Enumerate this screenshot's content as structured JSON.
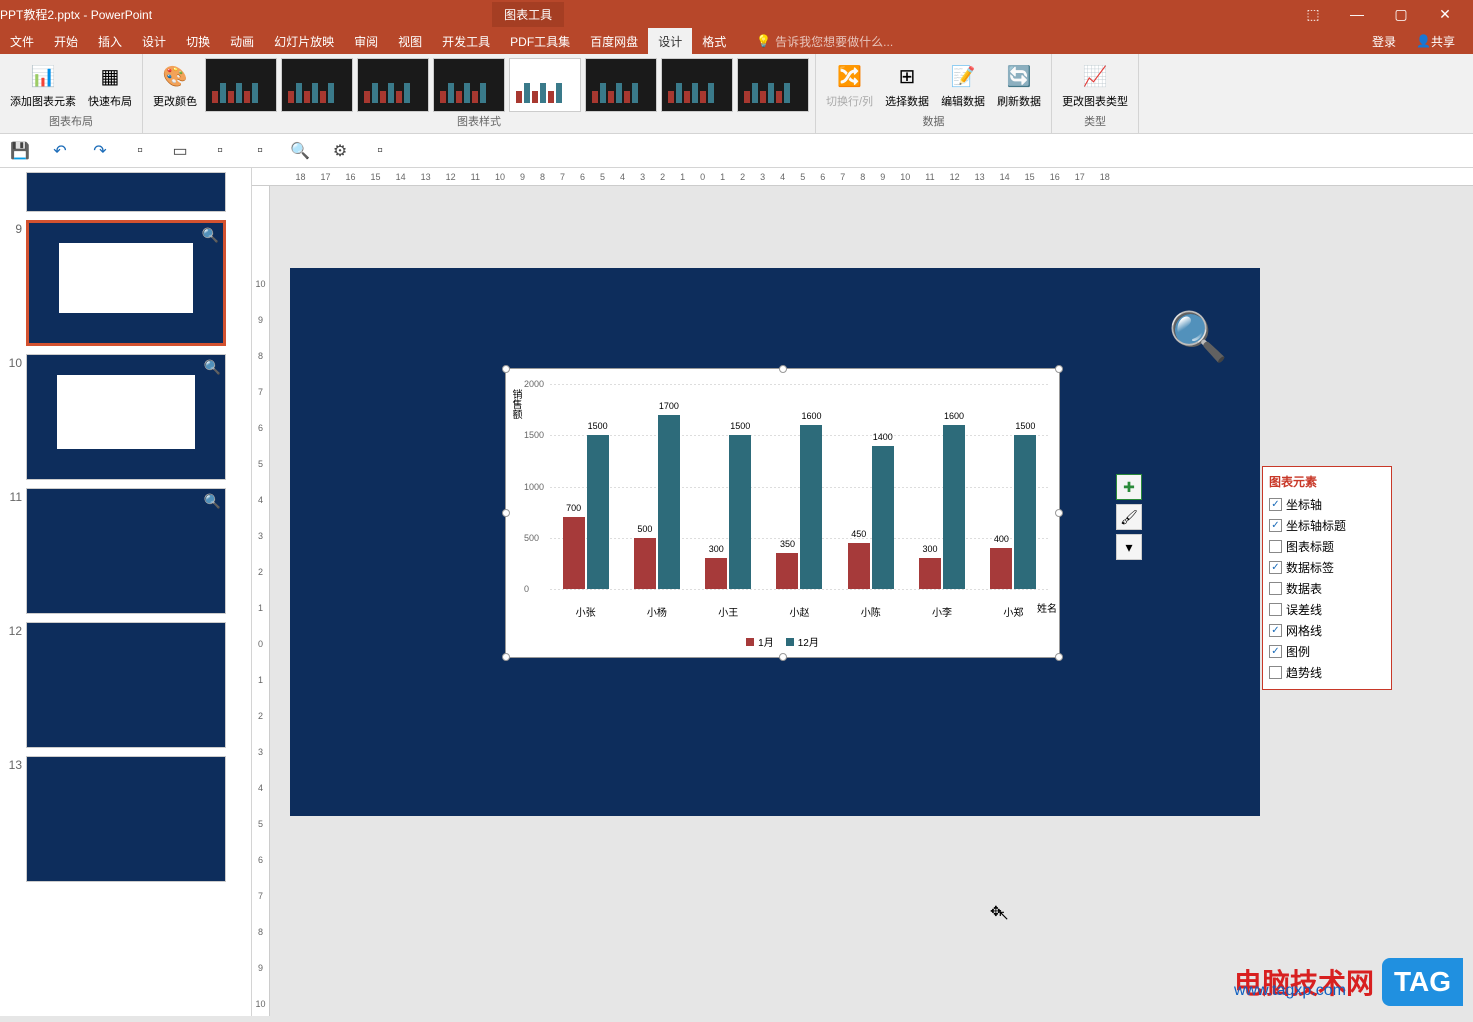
{
  "titlebar": {
    "title": "PPT教程2.pptx - PowerPoint",
    "context_tab": "图表工具"
  },
  "win": {
    "minimize": "—",
    "maximize": "▢",
    "close": "✕",
    "opts": "⬚"
  },
  "menu": {
    "items": [
      "文件",
      "开始",
      "插入",
      "设计",
      "切换",
      "动画",
      "幻灯片放映",
      "审阅",
      "视图",
      "开发工具",
      "PDF工具集",
      "百度网盘"
    ],
    "design": "设计",
    "format": "格式",
    "tell_me": "告诉我您想要做什么...",
    "login": "登录",
    "share": "共享"
  },
  "ribbon": {
    "add_element": "添加图表元素",
    "quick_layout": "快速布局",
    "change_color": "更改颜色",
    "group_layout": "图表布局",
    "group_styles": "图表样式",
    "switch_rc": "切换行/列",
    "select_data": "选择数据",
    "edit_data": "编辑数据",
    "refresh_data": "刷新数据",
    "group_data": "数据",
    "change_type": "更改图表类型",
    "group_type": "类型"
  },
  "ruler_h": [
    "18",
    "17",
    "16",
    "15",
    "14",
    "13",
    "12",
    "11",
    "10",
    "9",
    "8",
    "7",
    "6",
    "5",
    "4",
    "3",
    "2",
    "1",
    "0",
    "1",
    "2",
    "3",
    "4",
    "5",
    "6",
    "7",
    "8",
    "9",
    "10",
    "11",
    "12",
    "13",
    "14",
    "15",
    "16",
    "17",
    "18"
  ],
  "ruler_v": [
    "10",
    "9",
    "8",
    "7",
    "6",
    "5",
    "4",
    "3",
    "2",
    "1",
    "0",
    "1",
    "2",
    "3",
    "4",
    "5",
    "6",
    "7",
    "8",
    "9",
    "10"
  ],
  "thumbs": {
    "s9": "9",
    "s10": "10",
    "s11": "11",
    "s12": "12",
    "s13": "13"
  },
  "chart_data": {
    "type": "bar",
    "y_title": "销售额",
    "x_title": "姓名",
    "categories": [
      "小张",
      "小杨",
      "小王",
      "小赵",
      "小陈",
      "小李",
      "小郑"
    ],
    "series": [
      {
        "name": "1月",
        "values": [
          700,
          500,
          300,
          350,
          450,
          300,
          400
        ],
        "color": "#a63a3a"
      },
      {
        "name": "12月",
        "values": [
          1500,
          1700,
          1500,
          1600,
          1400,
          1600,
          1500
        ],
        "color": "#2d6b7a"
      }
    ],
    "y_ticks": [
      0,
      500,
      1000,
      1500,
      2000
    ],
    "ylim": [
      0,
      2000
    ]
  },
  "popup": {
    "title": "图表元素",
    "items": [
      {
        "label": "坐标轴",
        "checked": true
      },
      {
        "label": "坐标轴标题",
        "checked": true
      },
      {
        "label": "图表标题",
        "checked": false
      },
      {
        "label": "数据标签",
        "checked": true
      },
      {
        "label": "数据表",
        "checked": false
      },
      {
        "label": "误差线",
        "checked": false
      },
      {
        "label": "网格线",
        "checked": true
      },
      {
        "label": "图例",
        "checked": true
      },
      {
        "label": "趋势线",
        "checked": false
      }
    ]
  },
  "watermark": {
    "text": "电脑技术网",
    "url": "www.tagxp.com",
    "tag": "TAG"
  }
}
